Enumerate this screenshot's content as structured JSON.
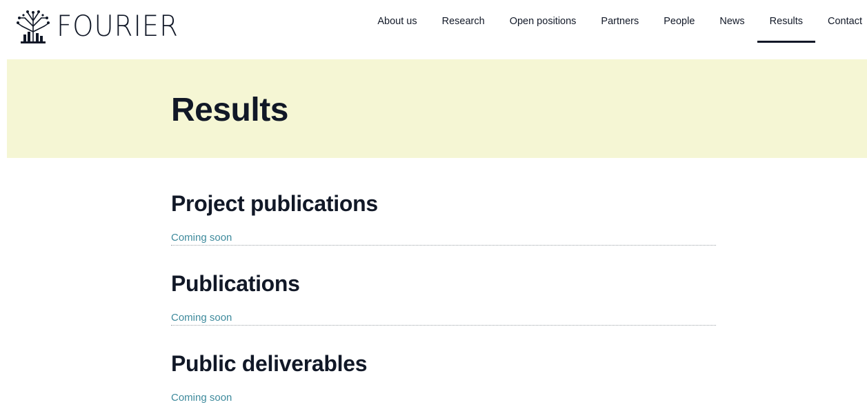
{
  "brand": {
    "name": "FOURIER"
  },
  "nav": {
    "items": [
      {
        "label": "About us"
      },
      {
        "label": "Research"
      },
      {
        "label": "Open positions"
      },
      {
        "label": "Partners"
      },
      {
        "label": "People"
      },
      {
        "label": "News"
      },
      {
        "label": "Results",
        "active": true
      },
      {
        "label": "Contact"
      }
    ]
  },
  "hero": {
    "title": "Results"
  },
  "sections": [
    {
      "heading": "Project publications",
      "text": "Coming soon"
    },
    {
      "heading": "Publications",
      "text": "Coming soon"
    },
    {
      "heading": "Public deliverables",
      "text": "Coming soon"
    }
  ],
  "colors": {
    "hero_background": "#f5f6d4",
    "heading": "#111827",
    "coming_soon": "#3e8a9c",
    "nav_active_underline": "#111827"
  }
}
